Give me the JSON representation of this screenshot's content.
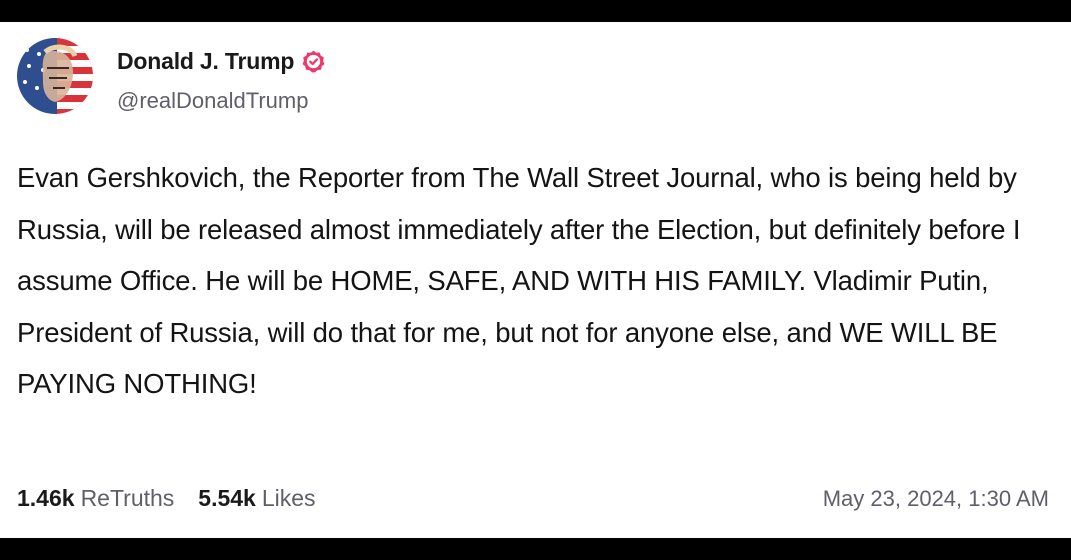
{
  "post": {
    "author": {
      "display_name": "Donald J. Trump",
      "handle": "@realDonaldTrump",
      "verified": true,
      "verified_icon": "verified-badge-icon",
      "avatar_icon": "profile-avatar"
    },
    "body": "Evan Gershkovich, the Reporter from The Wall Street Journal, who is being held by Russia, will be released almost immediately after the Election, but definitely before I assume Office. He will be HOME, SAFE, AND WITH HIS FAMILY. Vladimir Putin, President of Russia, will do that for me, but not for anyone else, and WE WILL BE PAYING NOTHING!",
    "stats": {
      "retruths_count": "1.46k",
      "retruths_label": "ReTruths",
      "likes_count": "5.54k",
      "likes_label": "Likes"
    },
    "timestamp": "May 23, 2024, 1:30 AM"
  },
  "colors": {
    "verified": "#f0386b",
    "text_primary": "#141414",
    "text_secondary": "#5f5f6b",
    "frame_border": "#000000"
  }
}
